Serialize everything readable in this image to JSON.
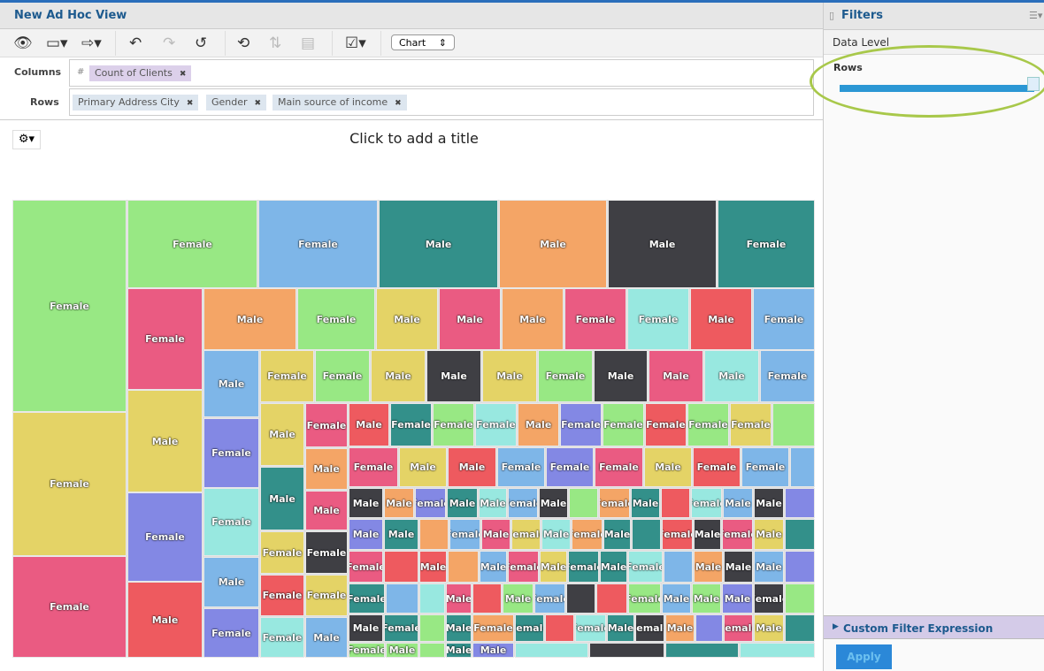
{
  "window": {
    "title": "New Ad Hoc View"
  },
  "toolbar": {
    "view_mode": "Chart",
    "icons": [
      "eye-icon",
      "save-icon",
      "export-icon",
      "undo-icon",
      "redo-icon",
      "undo-all-icon",
      "switch-icon",
      "sort-icon",
      "table-icon",
      "checklist-icon"
    ]
  },
  "columns": {
    "label": "Columns",
    "items": [
      {
        "prefix": "#",
        "label": "Count of Clients"
      }
    ]
  },
  "rows": {
    "label": "Rows",
    "items": [
      {
        "label": "Primary Address City"
      },
      {
        "label": "Gender"
      },
      {
        "label": "Main source of income"
      }
    ]
  },
  "chart": {
    "title_placeholder": "Click to add a title"
  },
  "filters": {
    "title": "Filters",
    "data_level": "Data Level",
    "rows_label": "Rows",
    "slider_level": 1.0,
    "custom_filter": "Custom Filter Expression",
    "apply": "Apply"
  },
  "colors": {
    "accent": "#2a6ebb",
    "highlight_ring": "#a8c84a",
    "slider": "#2b97d4"
  },
  "chart_data": {
    "type": "treemap",
    "labels": [
      "Female",
      "Male",
      ""
    ],
    "palette": {
      "g": "#98e884",
      "y": "#e4d366",
      "p": "#ea5b82",
      "b": "#7eb6e8",
      "t": "#33908a",
      "o": "#f4a566",
      "d": "#3f3f44",
      "c": "#98e8e0",
      "r": "#ee5a5f",
      "u": "#8388e4"
    }
  }
}
